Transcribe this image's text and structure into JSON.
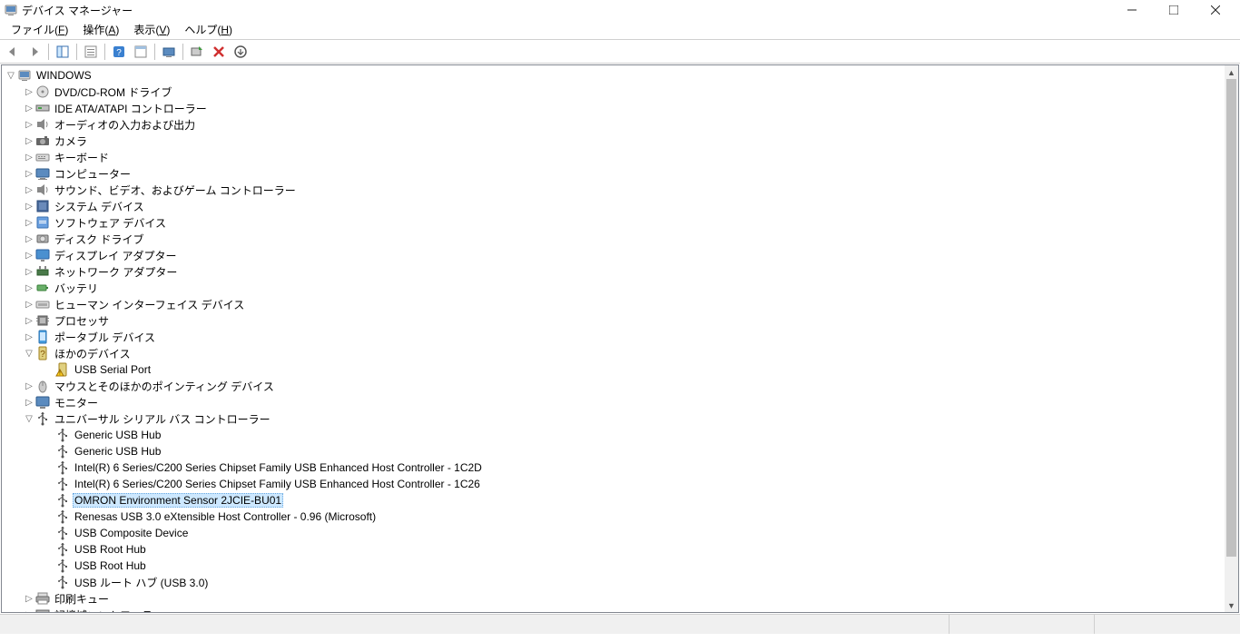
{
  "window": {
    "title": "デバイス マネージャー"
  },
  "menu": {
    "file": {
      "pre": "ファイル(",
      "ul": "F",
      "post": ")"
    },
    "action": {
      "pre": "操作(",
      "ul": "A",
      "post": ")"
    },
    "view": {
      "pre": "表示(",
      "ul": "V",
      "post": ")"
    },
    "help": {
      "pre": "ヘルプ(",
      "ul": "H",
      "post": ")"
    }
  },
  "tree": {
    "root": "WINDOWS",
    "items": [
      {
        "icon": "disc",
        "exp": ">",
        "label": "DVD/CD-ROM ドライブ"
      },
      {
        "icon": "ide",
        "exp": ">",
        "label": "IDE ATA/ATAPI コントローラー"
      },
      {
        "icon": "audio",
        "exp": ">",
        "label": "オーディオの入力および出力"
      },
      {
        "icon": "camera",
        "exp": ">",
        "label": "カメラ"
      },
      {
        "icon": "keyboard",
        "exp": ">",
        "label": "キーボード"
      },
      {
        "icon": "computer",
        "exp": ">",
        "label": "コンピューター"
      },
      {
        "icon": "audio",
        "exp": ">",
        "label": "サウンド、ビデオ、およびゲーム コントローラー"
      },
      {
        "icon": "system",
        "exp": ">",
        "label": "システム デバイス"
      },
      {
        "icon": "software",
        "exp": ">",
        "label": "ソフトウェア デバイス"
      },
      {
        "icon": "hdd",
        "exp": ">",
        "label": "ディスク ドライブ"
      },
      {
        "icon": "display",
        "exp": ">",
        "label": "ディスプレイ アダプター"
      },
      {
        "icon": "network",
        "exp": ">",
        "label": "ネットワーク アダプター"
      },
      {
        "icon": "battery",
        "exp": ">",
        "label": "バッテリ"
      },
      {
        "icon": "hid",
        "exp": ">",
        "label": "ヒューマン インターフェイス デバイス"
      },
      {
        "icon": "cpu",
        "exp": ">",
        "label": "プロセッサ"
      },
      {
        "icon": "portable",
        "exp": ">",
        "label": "ポータブル デバイス"
      },
      {
        "icon": "unknown",
        "exp": "v",
        "label": "ほかのデバイス",
        "children": [
          {
            "icon": "warn-usb",
            "label": "USB Serial Port"
          }
        ]
      },
      {
        "icon": "mouse",
        "exp": ">",
        "label": "マウスとそのほかのポインティング デバイス"
      },
      {
        "icon": "monitor",
        "exp": ">",
        "label": "モニター"
      },
      {
        "icon": "usb",
        "exp": "v",
        "label": "ユニバーサル シリアル バス コントローラー",
        "children": [
          {
            "icon": "usb",
            "label": "Generic USB Hub"
          },
          {
            "icon": "usb",
            "label": "Generic USB Hub"
          },
          {
            "icon": "usb",
            "label": "Intel(R) 6 Series/C200 Series Chipset Family USB Enhanced Host Controller - 1C2D"
          },
          {
            "icon": "usb",
            "label": "Intel(R) 6 Series/C200 Series Chipset Family USB Enhanced Host Controller - 1C26"
          },
          {
            "icon": "usb",
            "label": "OMRON Environment Sensor 2JCIE-BU01",
            "selected": true
          },
          {
            "icon": "usb",
            "label": "Renesas USB 3.0 eXtensible Host Controller - 0.96 (Microsoft)"
          },
          {
            "icon": "usb",
            "label": "USB Composite Device"
          },
          {
            "icon": "usb",
            "label": "USB Root Hub"
          },
          {
            "icon": "usb",
            "label": "USB Root Hub"
          },
          {
            "icon": "usb",
            "label": "USB ルート ハブ (USB 3.0)"
          }
        ]
      },
      {
        "icon": "printer",
        "exp": ">",
        "label": "印刷キュー"
      },
      {
        "icon": "storage",
        "exp": ">",
        "label": "記憶域コントローラー"
      }
    ]
  }
}
